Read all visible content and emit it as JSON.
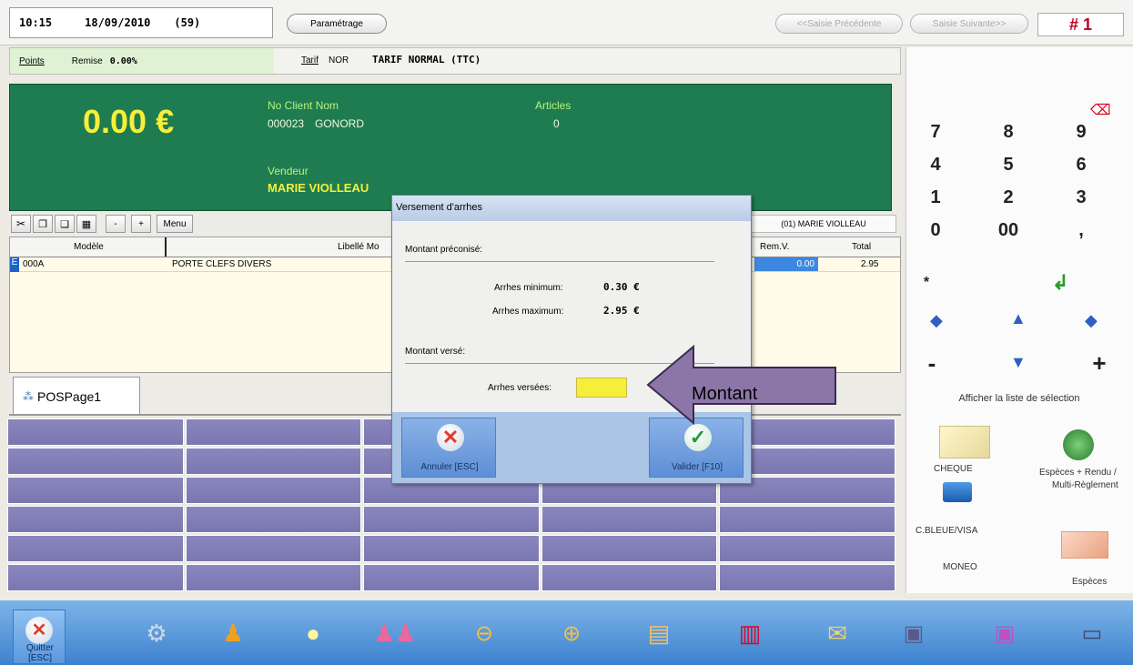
{
  "header": {
    "time": "10:15",
    "date": "18/09/2010",
    "count": "(59)",
    "settings_button": "Paramétrage",
    "prev_button": "<<Saisie Précédente",
    "next_button": "Saisie Suivante>>",
    "ticket_number": "# 1"
  },
  "infobar": {
    "points_label": "Points",
    "remise_label": "Remise",
    "remise_value": "0.00%",
    "tarif_label": "Tarif",
    "tarif_code": "NOR",
    "tarif_name": "TARIF NORMAL (TTC)"
  },
  "display": {
    "total": "0.00 €",
    "client_label": "No Client Nom",
    "client_number": "000023",
    "client_name": "GONORD",
    "articles_label": "Articles",
    "articles_count": "0",
    "vendeur_label": "Vendeur",
    "vendeur_name": "MARIE VIOLLEAU"
  },
  "toolbar": {
    "menu_label": "Menu",
    "minus_label": "-",
    "plus_label": "+",
    "seller_ref": "(01) MARIE VIOLLEAU"
  },
  "grid": {
    "columns": [
      "Modèle",
      "Libellé Mo",
      "Rem.V.",
      "Total"
    ],
    "row": {
      "marker": "E",
      "model": "000A",
      "label": "PORTE CLEFS DIVERS",
      "remv": "0.00",
      "total": "2.95"
    }
  },
  "tab": {
    "label": "POSPage1"
  },
  "keypad": {
    "rows": [
      [
        "7",
        "8",
        "9"
      ],
      [
        "4",
        "5",
        "6"
      ],
      [
        "1",
        "2",
        "3"
      ],
      [
        "0",
        "00",
        ","
      ]
    ],
    "star": "*",
    "minus": "-",
    "plus": "+",
    "list_label": "Afficher la liste de sélection",
    "payments": {
      "cheque": "CHEQUE",
      "especes_rendu": "Espèces + Rendu /",
      "multi": "Multi-Règlement",
      "cb": "C.BLEUE/VISA",
      "moneo": "MONEO",
      "especes": "Espèces"
    }
  },
  "dialog": {
    "title": "Versement d'arrhes",
    "section1": "Montant préconisé:",
    "min_label": "Arrhes minimum:",
    "min_value": "0.30 €",
    "max_label": "Arrhes maximum:",
    "max_value": "2.95 €",
    "section2": "Montant versé:",
    "paid_label": "Arrhes versées:",
    "paid_value": "",
    "cancel_button": "Annuler [ESC]",
    "validate_button": "Valider [F10]"
  },
  "callout": {
    "text": "Montant"
  },
  "bottom": {
    "quit_label": "Quitter [ESC]"
  },
  "colors": {
    "display_green": "#1e7c50",
    "amount_yellow": "#f6ef3a",
    "grid_purple": "#8a86be",
    "callout_purple": "#8c76a8",
    "ticket_red": "#c0001f"
  }
}
